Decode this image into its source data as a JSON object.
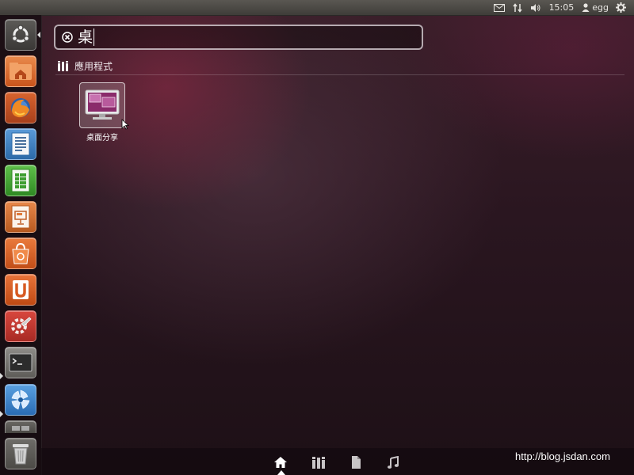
{
  "top_panel": {
    "clock": "15:05",
    "user": "egg",
    "icons": [
      "mail-icon",
      "network-icon",
      "volume-icon",
      "user-icon",
      "gear-icon"
    ]
  },
  "launcher": {
    "items": [
      {
        "name": "dash-home",
        "icon": "ubuntu-logo-icon"
      },
      {
        "name": "home-folder",
        "icon": "folder-home-icon"
      },
      {
        "name": "firefox",
        "icon": "firefox-icon"
      },
      {
        "name": "libreoffice-writer",
        "icon": "writer-icon"
      },
      {
        "name": "libreoffice-calc",
        "icon": "calc-icon"
      },
      {
        "name": "libreoffice-impress",
        "icon": "impress-icon"
      },
      {
        "name": "software-center",
        "icon": "shopping-bag-icon"
      },
      {
        "name": "ubuntu-one",
        "icon": "ubuntu-one-icon"
      },
      {
        "name": "system-settings",
        "icon": "settings-wrench-icon"
      },
      {
        "name": "terminal",
        "icon": "terminal-icon"
      },
      {
        "name": "shotwell",
        "icon": "shotwell-icon"
      },
      {
        "name": "workspace-switcher",
        "icon": "workspaces-icon"
      },
      {
        "name": "trash",
        "icon": "trash-icon"
      }
    ]
  },
  "search": {
    "value": "桌"
  },
  "category": {
    "label": "應用程式"
  },
  "results": [
    {
      "label": "桌面分享",
      "icon": "desktop-sharing-icon"
    }
  ],
  "lenses": [
    {
      "name": "home",
      "icon": "home-icon",
      "active": true
    },
    {
      "name": "applications",
      "icon": "applications-icon",
      "active": false
    },
    {
      "name": "files",
      "icon": "file-icon",
      "active": false
    },
    {
      "name": "music",
      "icon": "music-note-icon",
      "active": false
    }
  ],
  "watermark": "http://blog.jsdan.com",
  "colors": {
    "launcher_orange": "#e0622b",
    "launcher_green": "#3c9a2c",
    "accent_purple": "#8a2b6b"
  }
}
